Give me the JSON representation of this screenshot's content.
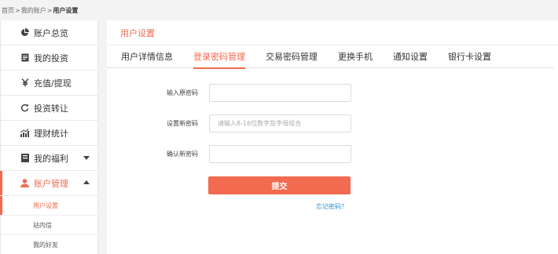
{
  "breadcrumb": {
    "home": "首页",
    "sep1": ">",
    "account": "我的账户",
    "sep2": ">",
    "current": "用户设置"
  },
  "sidebar": {
    "items": [
      {
        "label": "账户总览",
        "icon": "pie-chart-icon"
      },
      {
        "label": "我的投资",
        "icon": "document-icon"
      },
      {
        "label": "充值/提现",
        "icon": "yen-icon"
      },
      {
        "label": "投资转让",
        "icon": "refresh-icon"
      },
      {
        "label": "理财统计",
        "icon": "bar-chart-icon"
      },
      {
        "label": "我的福利",
        "icon": "gift-icon"
      },
      {
        "label": "账户管理",
        "icon": "user-icon"
      }
    ],
    "subitems": [
      {
        "label": "用户设置"
      },
      {
        "label": "站内信"
      },
      {
        "label": "我的好友"
      }
    ]
  },
  "main": {
    "title": "用户设置",
    "tabs": [
      {
        "label": "用户详情信息"
      },
      {
        "label": "登录密码管理"
      },
      {
        "label": "交易密码管理"
      },
      {
        "label": "更换手机"
      },
      {
        "label": "通知设置"
      },
      {
        "label": "银行卡设置"
      }
    ],
    "form": {
      "old_password_label": "输入原密码",
      "old_password_value": "",
      "new_password_label": "设置新密码",
      "new_password_placeholder": "请输入8-16位数字及字母组合",
      "confirm_password_label": "确认新密码",
      "confirm_password_value": "",
      "submit_label": "提交",
      "forgot_label": "忘记密码？"
    }
  },
  "colors": {
    "accent": "#f26a4f",
    "link": "#2a8ccf"
  }
}
